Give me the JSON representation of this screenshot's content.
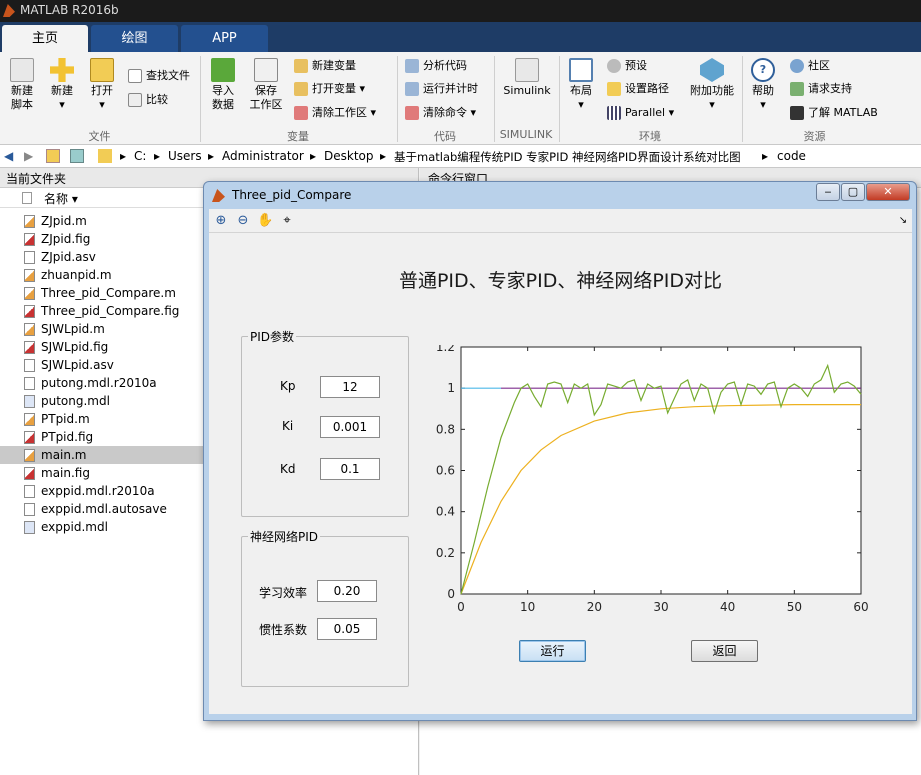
{
  "app": {
    "title": "MATLAB R2016b"
  },
  "tabs": [
    {
      "label": "主页",
      "active": true
    },
    {
      "label": "绘图",
      "active": false
    },
    {
      "label": "APP",
      "active": false
    }
  ],
  "ribbon": {
    "big_buttons": [
      {
        "label1": "新建",
        "label2": "脚本",
        "icon": "new-script-icon"
      },
      {
        "label1": "新建",
        "label2": "▾",
        "icon": "new-icon"
      },
      {
        "label1": "打开",
        "label2": "▾",
        "icon": "folder-open-icon"
      },
      {
        "label1": "导入",
        "label2": "数据",
        "icon": "import-data-icon"
      },
      {
        "label1": "保存",
        "label2": "工作区",
        "icon": "save-workspace-icon"
      },
      {
        "label1": "Simulink",
        "label2": "",
        "icon": "simulink-icon"
      },
      {
        "label1": "布局",
        "label2": "▾",
        "icon": "layout-icon"
      },
      {
        "label1": "附加功能",
        "label2": "▾",
        "icon": "addons-icon"
      },
      {
        "label1": "帮助",
        "label2": "▾",
        "icon": "help-icon"
      }
    ],
    "small_buttons": [
      {
        "label": "查找文件",
        "icon": "find-files-icon"
      },
      {
        "label": "比较",
        "icon": "compare-icon"
      },
      {
        "label": "新建变量",
        "icon": "new-variable-icon"
      },
      {
        "label": "打开变量 ▾",
        "icon": "open-variable-icon"
      },
      {
        "label": "清除工作区 ▾",
        "icon": "clear-workspace-icon"
      },
      {
        "label": "分析代码",
        "icon": "analyze-code-icon"
      },
      {
        "label": "运行并计时",
        "icon": "run-time-icon"
      },
      {
        "label": "清除命令 ▾",
        "icon": "clear-commands-icon"
      },
      {
        "label": "预设",
        "icon": "preferences-icon"
      },
      {
        "label": "设置路径",
        "icon": "set-path-icon"
      },
      {
        "label": "Parallel ▾",
        "icon": "parallel-icon"
      },
      {
        "label": "社区",
        "icon": "community-icon"
      },
      {
        "label": "请求支持",
        "icon": "request-support-icon"
      },
      {
        "label": "了解 MATLAB",
        "icon": "learn-matlab-icon"
      }
    ],
    "sections": [
      "文件",
      "变量",
      "代码",
      "SIMULINK",
      "环境",
      "资源"
    ]
  },
  "address": {
    "path": [
      "C:",
      "Users",
      "Administrator",
      "Desktop",
      "基于matlab编程传统PID 专家PID 神经网络PID界面设计系统对比图",
      "code"
    ]
  },
  "left_panel": {
    "title": "当前文件夹",
    "column": "名称 ▾",
    "files": [
      {
        "name": "ZJpid.m",
        "type": "m"
      },
      {
        "name": "ZJpid.fig",
        "type": "fig"
      },
      {
        "name": "ZJpid.asv",
        "type": "asv"
      },
      {
        "name": "zhuanpid.m",
        "type": "m"
      },
      {
        "name": "Three_pid_Compare.m",
        "type": "m"
      },
      {
        "name": "Three_pid_Compare.fig",
        "type": "fig"
      },
      {
        "name": "SJWLpid.m",
        "type": "m"
      },
      {
        "name": "SJWLpid.fig",
        "type": "fig"
      },
      {
        "name": "SJWLpid.asv",
        "type": "asv"
      },
      {
        "name": "putong.mdl.r2010a",
        "type": "asv"
      },
      {
        "name": "putong.mdl",
        "type": "mdl"
      },
      {
        "name": "PTpid.m",
        "type": "m"
      },
      {
        "name": "PTpid.fig",
        "type": "fig"
      },
      {
        "name": "main.m",
        "type": "m",
        "selected": true
      },
      {
        "name": "main.fig",
        "type": "fig"
      },
      {
        "name": "exppid.mdl.r2010a",
        "type": "asv"
      },
      {
        "name": "exppid.mdl.autosave",
        "type": "asv"
      },
      {
        "name": "exppid.mdl",
        "type": "mdl"
      }
    ]
  },
  "command_window": {
    "title": "命令行窗口"
  },
  "figure": {
    "window_title": "Three_pid_Compare",
    "heading": "普通PID、专家PID、神经网络PID对比",
    "pid_group": {
      "title": "PID参数",
      "kp_label": "Kp",
      "kp": "12",
      "ki_label": "Ki",
      "ki": "0.001",
      "kd_label": "Kd",
      "kd": "0.1"
    },
    "nn_group": {
      "title": "神经网络PID",
      "lr_label": "学习效率",
      "lr": "0.20",
      "mom_label": "惯性系数",
      "mom": "0.05"
    },
    "run_button": "运行",
    "back_button": "返回"
  },
  "chart_data": {
    "type": "line",
    "title": "",
    "xlabel": "",
    "ylabel": "",
    "xlim": [
      0,
      60
    ],
    "ylim": [
      0,
      1.2
    ],
    "xticks": [
      0,
      10,
      20,
      30,
      40,
      50,
      60
    ],
    "yticks": [
      0,
      0.2,
      0.4,
      0.6,
      0.8,
      1,
      1.2
    ],
    "series": [
      {
        "color": "#4db8e8",
        "points": [
          [
            0,
            1
          ],
          [
            6,
            1
          ]
        ]
      },
      {
        "color": "#7e2f8e",
        "points": [
          [
            6,
            1
          ],
          [
            60,
            1
          ]
        ]
      },
      {
        "color": "#edb120",
        "points": [
          [
            0,
            0
          ],
          [
            3,
            0.25
          ],
          [
            6,
            0.45
          ],
          [
            9,
            0.6
          ],
          [
            12,
            0.7
          ],
          [
            15,
            0.77
          ],
          [
            20,
            0.84
          ],
          [
            25,
            0.88
          ],
          [
            30,
            0.9
          ],
          [
            35,
            0.91
          ],
          [
            40,
            0.915
          ],
          [
            50,
            0.92
          ],
          [
            60,
            0.92
          ]
        ]
      },
      {
        "color": "#77ac30",
        "points": [
          [
            0,
            0
          ],
          [
            2,
            0.25
          ],
          [
            4,
            0.52
          ],
          [
            6,
            0.76
          ],
          [
            8,
            0.93
          ],
          [
            9,
            1.0
          ],
          [
            10,
            1.02
          ],
          [
            11,
            0.96
          ],
          [
            12,
            0.91
          ],
          [
            13,
            1.02
          ],
          [
            14,
            1.03
          ],
          [
            15,
            1.02
          ],
          [
            16,
            0.93
          ],
          [
            17,
            1.02
          ],
          [
            18,
            1.0
          ],
          [
            19,
            1.02
          ],
          [
            20,
            0.87
          ],
          [
            21,
            0.92
          ],
          [
            22,
            1.02
          ],
          [
            23,
            1.01
          ],
          [
            24,
            1.0
          ],
          [
            25,
            1.03
          ],
          [
            26,
            1.04
          ],
          [
            27,
            0.94
          ],
          [
            28,
            1.02
          ],
          [
            29,
            1.0
          ],
          [
            30,
            1.01
          ],
          [
            31,
            0.88
          ],
          [
            32,
            0.95
          ],
          [
            33,
            1.02
          ],
          [
            34,
            1.04
          ],
          [
            35,
            0.94
          ],
          [
            36,
            1.02
          ],
          [
            37,
            1.0
          ],
          [
            38,
            0.88
          ],
          [
            39,
            0.98
          ],
          [
            40,
            1.02
          ],
          [
            41,
            1.03
          ],
          [
            42,
            0.92
          ],
          [
            43,
            1.02
          ],
          [
            44,
            1.01
          ],
          [
            45,
            0.97
          ],
          [
            46,
            1.02
          ],
          [
            47,
            1.03
          ],
          [
            48,
            0.91
          ],
          [
            49,
            1.0
          ],
          [
            50,
            1.02
          ],
          [
            51,
            1.0
          ],
          [
            52,
            0.96
          ],
          [
            53,
            1.02
          ],
          [
            54,
            1.04
          ],
          [
            55,
            1.11
          ],
          [
            56,
            0.98
          ],
          [
            57,
            1.02
          ],
          [
            58,
            1.03
          ],
          [
            59,
            1.01
          ],
          [
            60,
            0.97
          ]
        ]
      }
    ]
  }
}
